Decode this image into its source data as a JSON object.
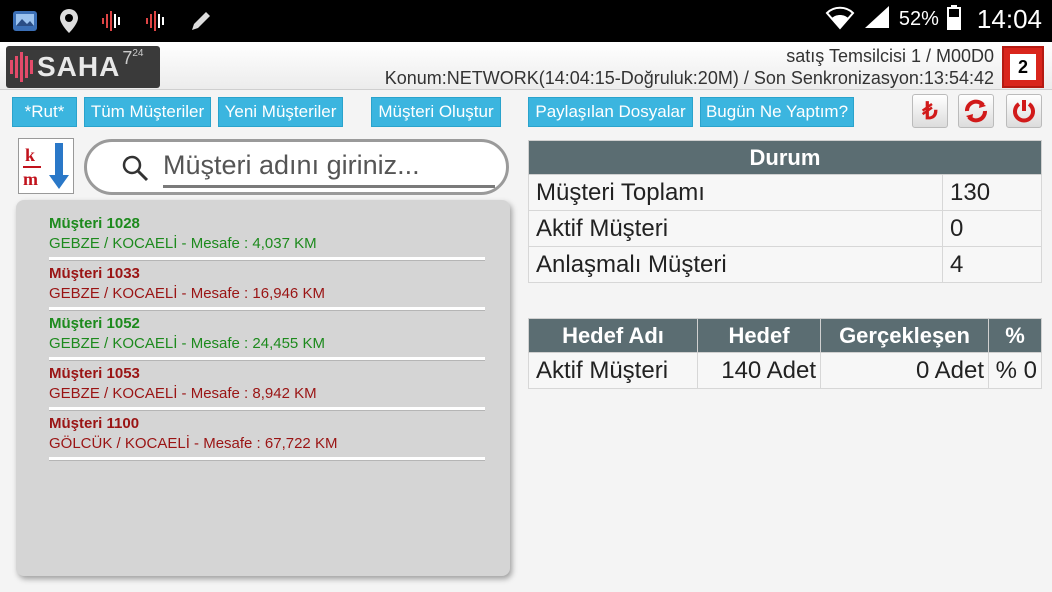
{
  "status_bar": {
    "left_icons": [
      "gallery-icon",
      "location-pin-icon",
      "signal-wave-icon",
      "signal-wave-icon",
      "pencil-icon"
    ],
    "battery_percent": "52%",
    "time": "14:04"
  },
  "header": {
    "logo_text": "SAHA",
    "logo_sup": "7",
    "logo_sup_small": "24",
    "user_line": "satış Temsilcisi 1 / M00D0",
    "location_line": "Konum:NETWORK(14:04:15-Doğruluk:20M) / Son Senkronizasyon:13:54:42",
    "notification_count": "2"
  },
  "nav": {
    "rut": "*Rut*",
    "tum_musteriler": "Tüm Müşteriler",
    "yeni_musteriler": "Yeni Müşteriler",
    "musteri_olustur": "Müşteri Oluştur",
    "paylasilan_dosyalar": "Paylaşılan Dosyalar",
    "bugun_ne_yaptim": "Bugün Ne Yaptım?",
    "currency_glyph": "₺"
  },
  "search": {
    "placeholder": "Müşteri adını giriniz...",
    "value": ""
  },
  "customers": [
    {
      "name": "Müşteri 1028",
      "detail": "GEBZE / KOCAELİ - Mesafe : 4,037 KM",
      "color": "#1d8a1d"
    },
    {
      "name": "Müşteri 1033",
      "detail": "GEBZE / KOCAELİ - Mesafe : 16,946 KM",
      "color": "#9a1414"
    },
    {
      "name": "Müşteri 1052",
      "detail": "GEBZE / KOCAELİ - Mesafe : 24,455 KM",
      "color": "#1d8a1d"
    },
    {
      "name": "Müşteri 1053",
      "detail": "GEBZE / KOCAELİ - Mesafe : 8,942 KM",
      "color": "#9a1414"
    },
    {
      "name": "Müşteri 1100",
      "detail": "GÖLCÜK / KOCAELİ - Mesafe : 67,722 KM",
      "color": "#9a1414"
    }
  ],
  "durum": {
    "title": "Durum",
    "rows": [
      {
        "label": "Müşteri Toplamı",
        "value": "130"
      },
      {
        "label": "Aktif Müşteri",
        "value": "0"
      },
      {
        "label": "Anlaşmalı Müşteri",
        "value": "4"
      }
    ]
  },
  "hedef": {
    "headers": [
      "Hedef Adı",
      "Hedef",
      "Gerçekleşen",
      "%"
    ],
    "rows": [
      {
        "name": "Aktif Müşteri",
        "target": "140 Adet",
        "actual": "0 Adet",
        "percent": "% 0"
      }
    ]
  },
  "colors": {
    "nav_button": "#3bb5df",
    "table_header": "#5b6d72",
    "notification": "#d9251c",
    "action_icon": "#d11a1a"
  }
}
